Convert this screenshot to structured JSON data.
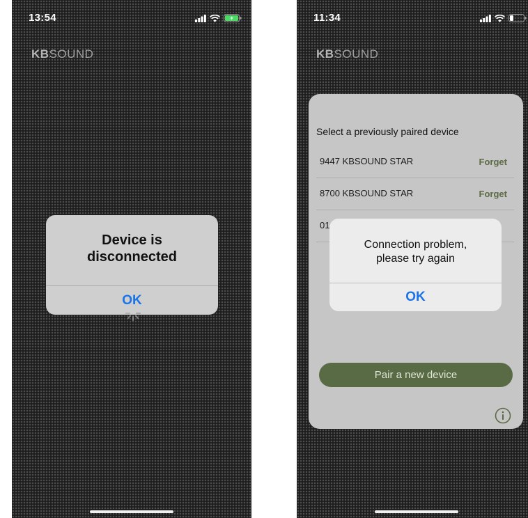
{
  "left_screen": {
    "status_bar": {
      "time": "13:54",
      "icons": [
        "signal-bars-icon",
        "wifi-icon",
        "battery-charging-icon"
      ]
    },
    "brand": {
      "bold": "KB",
      "regular": "SOUND"
    },
    "alert": {
      "title": "Device is\ndisconnected",
      "ok_label": "OK"
    },
    "spinner_icon": "loading-spinner-icon"
  },
  "right_screen": {
    "status_bar": {
      "time": "11:34",
      "icons": [
        "signal-bars-icon",
        "wifi-icon",
        "battery-low-icon"
      ]
    },
    "brand": {
      "bold": "KB",
      "regular": "SOUND"
    },
    "device_sheet": {
      "title": "Select a previously paired device",
      "devices": [
        {
          "name": "9447 KBSOUND STAR",
          "action": "Forget"
        },
        {
          "name": "8700 KBSOUND STAR",
          "action": "Forget"
        },
        {
          "name": "01",
          "action": ""
        }
      ],
      "pair_button_label": "Pair a new device",
      "info_icon": "info-circle-icon"
    },
    "alert": {
      "title": "Connection problem,\nplease try again",
      "ok_label": "OK"
    }
  },
  "colors": {
    "alert_ok": "#1a73e8",
    "accent_green": "#596b45",
    "forget_text": "#5d6b45",
    "sheet_bg": "#c6c6c6"
  }
}
